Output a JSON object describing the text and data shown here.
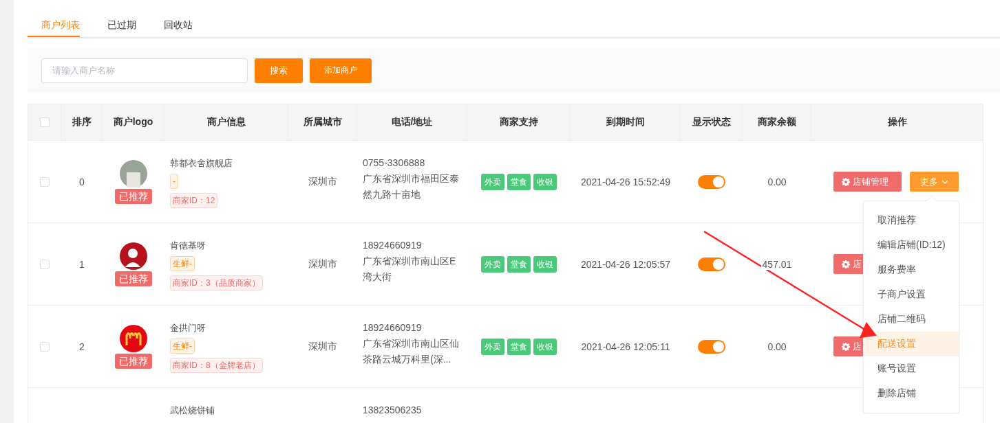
{
  "tabs": [
    {
      "label": "商户列表",
      "selected": true
    },
    {
      "label": "已过期",
      "selected": false
    },
    {
      "label": "回收站",
      "selected": false
    }
  ],
  "toolbar": {
    "search": {
      "placeholder": "请输入商户名称"
    },
    "search_button": "搜索",
    "add_button": "添加商户"
  },
  "table": {
    "header_checked": false,
    "columns": [
      "排序",
      "商户logo",
      "商户信息",
      "所属城市",
      "电话/地址",
      "商家支持",
      "到期时间",
      "显示状态",
      "商家余额",
      "操作"
    ],
    "rows": [
      {
        "checked": false,
        "order": "0",
        "logo": {
          "kind": "photo"
        },
        "badge": "已推荐",
        "name": "韩都衣舍旗舰店",
        "category": "-",
        "merchant_id": "商家ID：12",
        "city": "深圳市",
        "phone": "0755-3306888",
        "address": "广东省深圳市福田区泰然九路十亩地",
        "support": [
          "外卖",
          "堂食",
          "收银"
        ],
        "expires": "2021-04-26 15:52:49",
        "visible": true,
        "balance": "0.00",
        "manage_button": "店铺管理",
        "more_button": "更多"
      },
      {
        "checked": false,
        "order": "1",
        "logo": {
          "kind": "bucket"
        },
        "badge": "已推荐",
        "name": "肯德基呀",
        "category": "生鲜-",
        "merchant_id": "商家ID：3（品质商家）",
        "city": "深圳市",
        "phone": "18924660919",
        "address": "广东省深圳市南山区E湾大街",
        "support": [
          "外卖",
          "堂食",
          "收银"
        ],
        "expires": "2021-04-26 12:05:57",
        "visible": true,
        "balance": "457.01",
        "manage_button": "店"
      },
      {
        "checked": false,
        "order": "2",
        "logo": {
          "kind": "arches"
        },
        "badge": "已推荐",
        "name": "金拱门呀",
        "category": "生鲜-",
        "merchant_id": "商家ID：8（金牌老店）",
        "city": "深圳市",
        "phone": "18924660919",
        "address": "广东省深圳市南山区仙茶路云城万科里(深...",
        "support": [
          "外卖",
          "堂食",
          "收银"
        ],
        "expires": "2021-04-26 12:05:11",
        "visible": true,
        "balance": "0.00",
        "manage_button": "店"
      },
      {
        "name": "武松烧饼铺",
        "phone": "13823506235"
      }
    ]
  },
  "more_menu": {
    "items": [
      {
        "label": "取消推荐",
        "selected": false
      },
      {
        "label": "编辑店铺(ID:12)",
        "selected": false
      },
      {
        "label": "服务费率",
        "selected": false
      },
      {
        "label": "子商户设置",
        "selected": false
      },
      {
        "label": "店铺二维码",
        "selected": false
      },
      {
        "label": "配送设置",
        "selected": true
      },
      {
        "label": "账号设置",
        "selected": false
      },
      {
        "label": "删除店铺",
        "selected": false
      }
    ]
  }
}
